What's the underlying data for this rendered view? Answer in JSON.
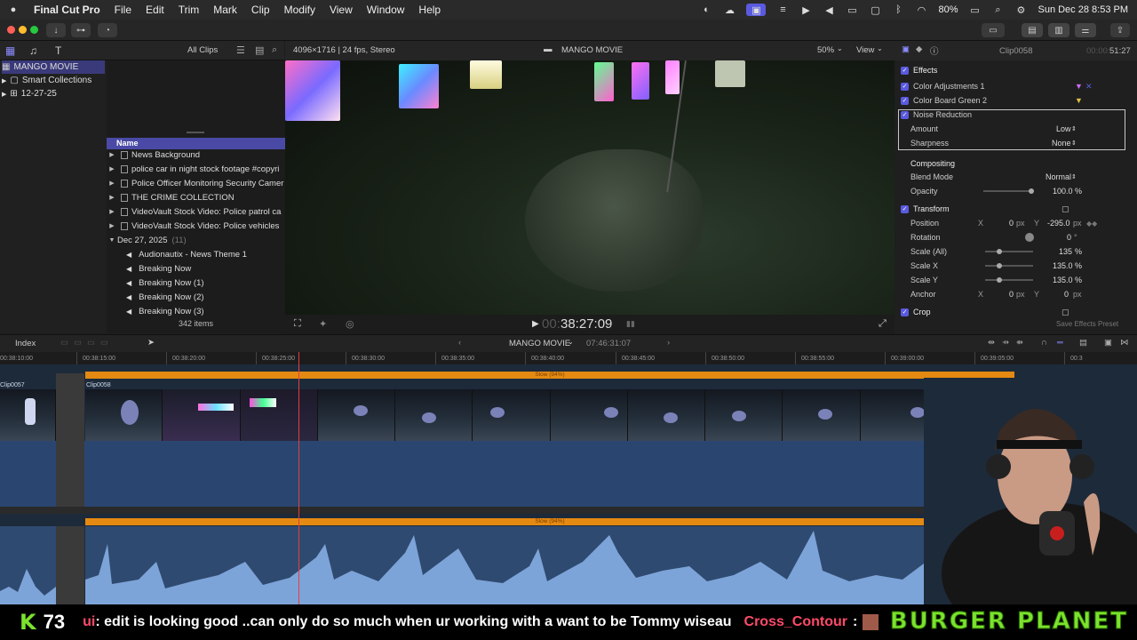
{
  "menubar": {
    "app": "Final Cut Pro",
    "items": [
      "File",
      "Edit",
      "Trim",
      "Mark",
      "Clip",
      "Modify",
      "View",
      "Window",
      "Help"
    ],
    "battery": "80%",
    "datetime": "Sun Dec 28  8:53 PM"
  },
  "library": {
    "filter": "All Clips",
    "items": [
      {
        "label": "MANGO MOVIE",
        "selected": true
      },
      {
        "label": "Smart Collections",
        "selected": false
      },
      {
        "label": "12-27-25",
        "selected": false
      }
    ]
  },
  "browser": {
    "column_name": "Name",
    "rows": [
      {
        "label": "News Background",
        "type": "folder"
      },
      {
        "label": "police  car in night stock footage #copyri",
        "type": "clip"
      },
      {
        "label": "Police Officer Monitoring Security Camer",
        "type": "clip"
      },
      {
        "label": "THE CRIME COLLECTION",
        "type": "clip"
      },
      {
        "label": "VideoVault Stock Video:  Police patrol ca",
        "type": "clip"
      },
      {
        "label": "VideoVault Stock Video:  Police vehicles",
        "type": "clip"
      }
    ],
    "date_group": "Dec 27, 2025",
    "date_group_count": "(11)",
    "audio_rows": [
      "Audionautix - News Theme 1",
      "Breaking Now",
      "Breaking Now (1)",
      "Breaking Now (2)",
      "Breaking Now (3)"
    ],
    "item_count": "342 items"
  },
  "viewer": {
    "format": "4096×1716 | 24 fps, Stereo",
    "title": "MANGO MOVIE",
    "zoom": "50%",
    "view_label": "View",
    "timecode_dim": "00:",
    "timecode": "38:27:09"
  },
  "inspector": {
    "clip_name": "Clip0058",
    "duration_dim": "00:00:",
    "duration": "51:27",
    "effects_label": "Effects",
    "effects": [
      "Color Adjustments 1",
      "Color Board Green 2",
      "Noise Reduction"
    ],
    "noise": {
      "amount_label": "Amount",
      "amount": "Low",
      "sharpness_label": "Sharpness",
      "sharpness": "None"
    },
    "compositing_label": "Compositing",
    "blend_label": "Blend Mode",
    "blend": "Normal",
    "opacity_label": "Opacity",
    "opacity": "100.0",
    "opacity_unit": "%",
    "transform_label": "Transform",
    "position_label": "Position",
    "pos_x_label": "X",
    "pos_x": "0",
    "pos_x_unit": "px",
    "pos_y_label": "Y",
    "pos_y": "-295.0",
    "pos_y_unit": "px",
    "rotation_label": "Rotation",
    "rotation": "0",
    "rotation_unit": "°",
    "scale_all_label": "Scale (All)",
    "scale_all": "135",
    "scale_all_unit": "%",
    "scale_x_label": "Scale X",
    "scale_x": "135.0",
    "scale_x_unit": "%",
    "scale_y_label": "Scale Y",
    "scale_y": "135.0",
    "scale_y_unit": "%",
    "anchor_label": "Anchor",
    "anchor_x_label": "X",
    "anchor_x": "0",
    "anchor_x_unit": "px",
    "anchor_y_label": "Y",
    "anchor_y": "0",
    "anchor_y_unit": "px",
    "crop_label": "Crop",
    "save_preset": "Save Effects Preset"
  },
  "timeline": {
    "index_label": "Index",
    "project": "MANGO MOVIE",
    "project_duration": "07:46:31:07",
    "ruler_ticks": [
      "00:38:10:00",
      "00:38:15:00",
      "00:38:20:00",
      "00:38:25:00",
      "00:38:30:00",
      "00:38:35:00",
      "00:38:40:00",
      "00:38:45:00",
      "00:38:50:00",
      "00:38:55:00",
      "00:39:00:00",
      "00:39:05:00",
      "00:3"
    ],
    "speed_label": "Slow (94%)",
    "clips": [
      "Clip0057",
      "Clip0058"
    ]
  },
  "chat": {
    "kick_letter": "K",
    "viewer_count": "73",
    "message_user_tail": "ui",
    "message": ": edit is looking good ..can only do so much when ur working with a want to be Tommy wiseau",
    "next_user": "Cross_Contour",
    "next_colon": ":",
    "banner": "BURGER PLANET"
  },
  "colors": {
    "accent": "#5a5ae0",
    "speed_bar": "#e48a12",
    "playhead": "#e04040",
    "kick_green": "#7be22e",
    "chat_user": "#ff4a6a"
  }
}
